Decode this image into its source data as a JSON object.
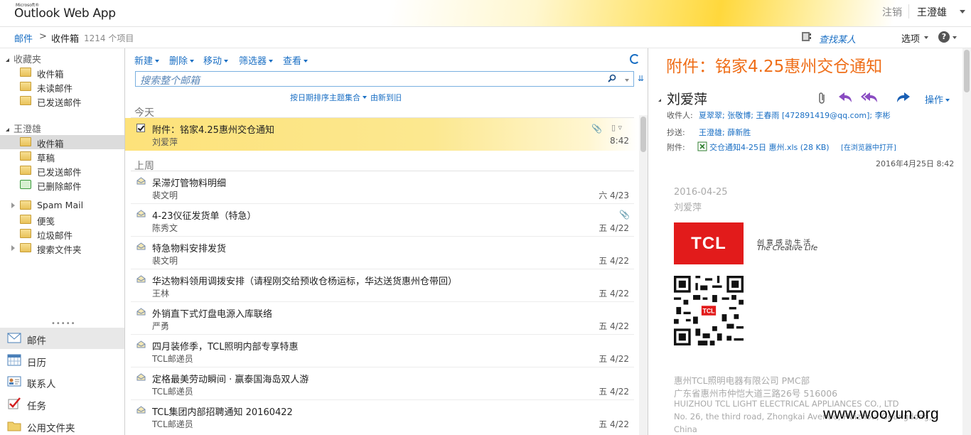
{
  "header": {
    "logo_small": "Microsoft®",
    "logo": "Outlook Web App",
    "signout": "注销",
    "user": "王澄雄"
  },
  "breadcrumb": {
    "mail": "邮件",
    "sep": ">",
    "inbox": "收件箱",
    "count": "1214 个项目"
  },
  "topright": {
    "find_person": "查找某人",
    "options": "选项",
    "help": "?"
  },
  "nav": {
    "favorites_title": "收藏夹",
    "favorites": [
      "收件箱",
      "未读邮件",
      "已发送邮件"
    ],
    "account_title": "王澄雄",
    "folders": [
      "收件箱",
      "草稿",
      "已发送邮件",
      "已删除邮件",
      "Spam Mail",
      "便笺",
      "垃圾邮件",
      "搜索文件夹"
    ],
    "modules": [
      "邮件",
      "日历",
      "联系人",
      "任务",
      "公用文件夹"
    ]
  },
  "toolbar": {
    "new": "新建",
    "delete": "删除",
    "move": "移动",
    "filter": "筛选器",
    "view": "查看",
    "search_placeholder": "搜索整个邮箱",
    "sort": "按日期排序主题集合",
    "order": "由新到旧"
  },
  "groups": {
    "today": "今天",
    "last_week": "上周"
  },
  "messages": [
    {
      "subject": "附件：铭家4.25惠州交仓通知",
      "from": "刘爱萍",
      "date": "8:42",
      "attachment": true
    },
    {
      "subject": "呆滞灯管物料明细",
      "from": "裴文明",
      "date": "六 4/23",
      "attachment": false
    },
    {
      "subject": "4-23仪征发货单（特急）",
      "from": "陈秀文",
      "date": "五 4/22",
      "attachment": true
    },
    {
      "subject": "特急物料安排发货",
      "from": "裴文明",
      "date": "五 4/22",
      "attachment": false
    },
    {
      "subject": "华达物料领用调拨安排（请程刚交给预收仓杨运标，华达送货惠州仓带回）",
      "from": "王林",
      "date": "五 4/22",
      "attachment": false
    },
    {
      "subject": "外销直下式灯盘电源入库联络",
      "from": "严勇",
      "date": "五 4/22",
      "attachment": false
    },
    {
      "subject": "四月装修季，TCL照明内部专享特惠",
      "from": "TCL邮递员",
      "date": "五 4/22",
      "attachment": false
    },
    {
      "subject": "定格最美劳动瞬间 · 赢泰国海岛双人游",
      "from": "TCL邮递员",
      "date": "五 4/22",
      "attachment": false
    },
    {
      "subject": "TCL集团内部招聘通知 20160422",
      "from": "TCL邮递员",
      "date": "五 4/22",
      "attachment": false
    }
  ],
  "reading": {
    "title": "附件：铭家4.25惠州交仓通知",
    "sender": "刘爱萍",
    "action": "操作",
    "to_label": "收件人:",
    "to": "夏翠翠; 张敬博; 王春雨 [472891419@qq.com]; 李彬",
    "cc_label": "抄送:",
    "cc": "王澄雄; 薛新胜",
    "att_label": "附件:",
    "attachment": "交仓通知4-25日 惠州.xls (28 KB)",
    "open_in_browser": "[在浏览器中打开]",
    "date": "2016年4月25日 8:42",
    "body_date": "2016-04-25",
    "body_name": "刘爱萍",
    "logo_text": "TCL",
    "slogan_cn": "创意感动生活",
    "slogan_en": "The Creative Life",
    "qr_logo": "TCL",
    "company": "惠州TCL照明电器有限公司  PMC部",
    "address_cn": "广东省惠州市仲恺大道三路26号  516006",
    "company_en": "HUIZHOU TCL LIGHT ELECTRICAL APPLIANCES CO., LTD",
    "address_en": "No. 26, the third road, Zhongkai Avenue, Huizhou, Guangdong,",
    "country": "China"
  },
  "watermark": "www.wooyun.org",
  "colors": {
    "accent": "#1a6fc4",
    "title_orange": "#ef6e18",
    "selected_row": "#fce890",
    "tcl_red": "#e21b1b"
  }
}
